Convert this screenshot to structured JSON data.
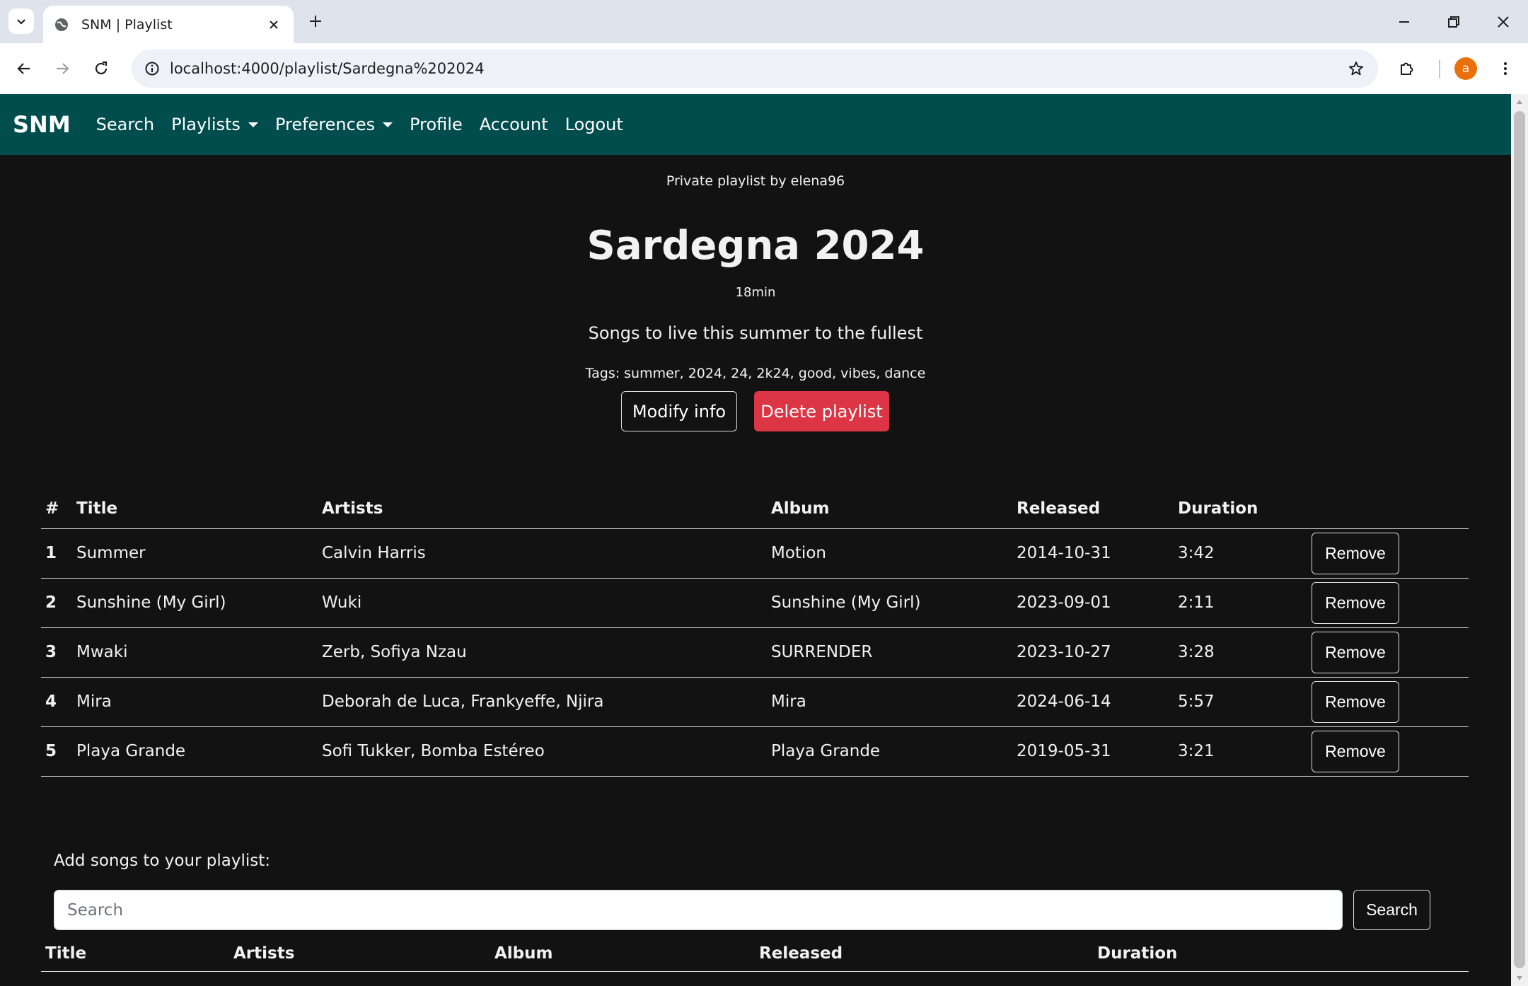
{
  "browser": {
    "tab_title": "SNM | Playlist",
    "url": "localhost:4000/playlist/Sardegna%202024",
    "profile_initial": "a"
  },
  "navbar": {
    "brand": "SNM",
    "links": {
      "search": "Search",
      "playlists": "Playlists",
      "preferences": "Preferences",
      "profile": "Profile",
      "account": "Account",
      "logout": "Logout"
    }
  },
  "playlist": {
    "byline": "Private playlist by elena96",
    "title": "Sardegna 2024",
    "duration": "18min",
    "description": "Songs to live this summer to the fullest",
    "tags": "Tags: summer, 2024, 24, 2k24, good, vibes, dance",
    "modify_label": "Modify info",
    "delete_label": "Delete playlist"
  },
  "songs_table": {
    "headers": {
      "num": "#",
      "title": "Title",
      "artists": "Artists",
      "album": "Album",
      "released": "Released",
      "duration": "Duration"
    },
    "remove_label": "Remove",
    "rows": [
      {
        "num": "1",
        "title": "Summer",
        "artists": "Calvin Harris",
        "album": "Motion",
        "released": "2014-10-31",
        "duration": "3:42"
      },
      {
        "num": "2",
        "title": "Sunshine (My Girl)",
        "artists": "Wuki",
        "album": "Sunshine (My Girl)",
        "released": "2023-09-01",
        "duration": "2:11"
      },
      {
        "num": "3",
        "title": "Mwaki",
        "artists": "Zerb, Sofiya Nzau",
        "album": "SURRENDER",
        "released": "2023-10-27",
        "duration": "3:28"
      },
      {
        "num": "4",
        "title": "Mira",
        "artists": "Deborah de Luca, Frankyeffe, Njira",
        "album": "Mira",
        "released": "2024-06-14",
        "duration": "5:57"
      },
      {
        "num": "5",
        "title": "Playa Grande",
        "artists": "Sofi Tukker, Bomba Estéreo",
        "album": "Playa Grande",
        "released": "2019-05-31",
        "duration": "3:21"
      }
    ]
  },
  "add_songs": {
    "label": "Add songs to your playlist:",
    "placeholder": "Search",
    "button": "Search",
    "headers": {
      "title": "Title",
      "artists": "Artists",
      "album": "Album",
      "released": "Released",
      "duration": "Duration"
    }
  },
  "colors": {
    "navbar_bg": "#014d4e",
    "page_bg": "#121212",
    "danger": "#dc3545",
    "avatar": "#e8710a"
  }
}
